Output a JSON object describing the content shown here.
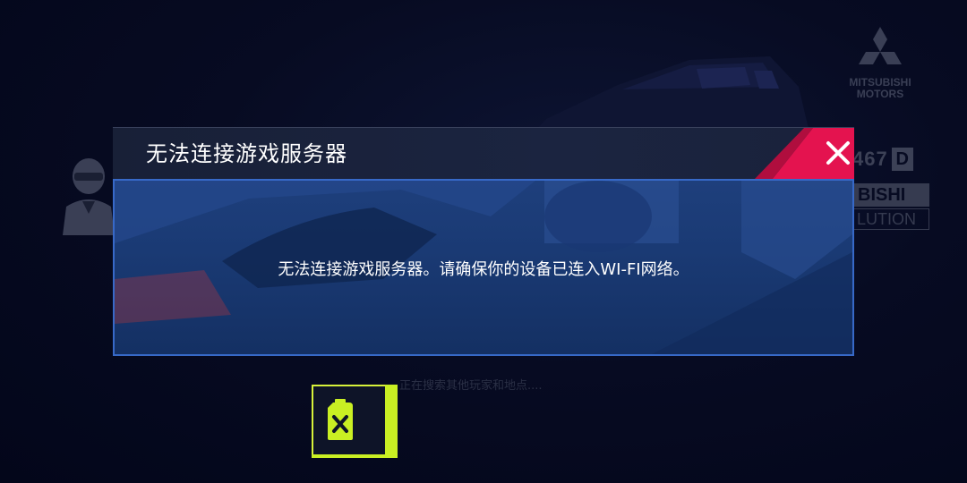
{
  "background": {
    "brand": {
      "name": "MITSUBISHI\nMOTORS",
      "icon": "mitsubishi-three-diamond-icon"
    },
    "car": {
      "performance_rating": "467",
      "class": "D",
      "model_line1": "BISHI",
      "model_line2": "LUTION"
    },
    "player_icon": "racer-helmet-icon",
    "search_status": "正在搜索其他玩家和地点....",
    "fuel_icon": "fuel-can-empty-icon"
  },
  "dialog": {
    "title": "无法连接游戏服务器",
    "message": "无法连接游戏服务器。请确保你的设备已连入WI-FI网络。",
    "close_icon": "close-icon"
  },
  "colors": {
    "accent_close": "#e4134f",
    "dialog_border": "#3769c8",
    "fuel_accent": "#c9ef23",
    "background": "#05081a"
  }
}
